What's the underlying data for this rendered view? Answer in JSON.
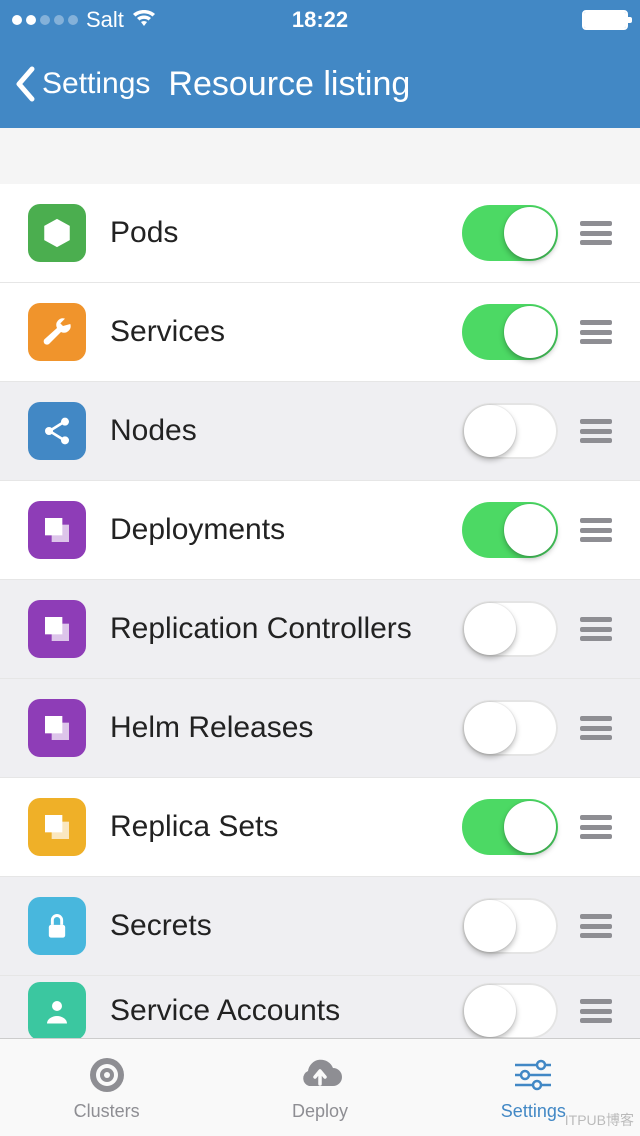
{
  "status": {
    "carrier": "Salt",
    "time": "18:22",
    "signal_filled": 2,
    "signal_total": 5
  },
  "nav": {
    "back_label": "Settings",
    "title": "Resource listing"
  },
  "resources": [
    {
      "label": "Pods",
      "enabled": true,
      "icon": "cube",
      "color": "#4bae4f"
    },
    {
      "label": "Services",
      "enabled": true,
      "icon": "wrench",
      "color": "#f0942c"
    },
    {
      "label": "Nodes",
      "enabled": false,
      "icon": "share",
      "color": "#4288c5"
    },
    {
      "label": "Deployments",
      "enabled": true,
      "icon": "stack",
      "color": "#8e3db7"
    },
    {
      "label": "Replication Controllers",
      "enabled": false,
      "icon": "stack",
      "color": "#8e3db7"
    },
    {
      "label": "Helm Releases",
      "enabled": false,
      "icon": "stack",
      "color": "#8e3db7"
    },
    {
      "label": "Replica Sets",
      "enabled": true,
      "icon": "stack",
      "color": "#efb028"
    },
    {
      "label": "Secrets",
      "enabled": false,
      "icon": "lock",
      "color": "#48b7dd"
    },
    {
      "label": "Service Accounts",
      "enabled": false,
      "icon": "user",
      "color": "#3bc7a0"
    }
  ],
  "tabs": [
    {
      "label": "Clusters",
      "icon": "target",
      "active": false
    },
    {
      "label": "Deploy",
      "icon": "cloud-up",
      "active": false
    },
    {
      "label": "Settings",
      "icon": "sliders",
      "active": true
    }
  ],
  "watermark": "ITPUB博客"
}
